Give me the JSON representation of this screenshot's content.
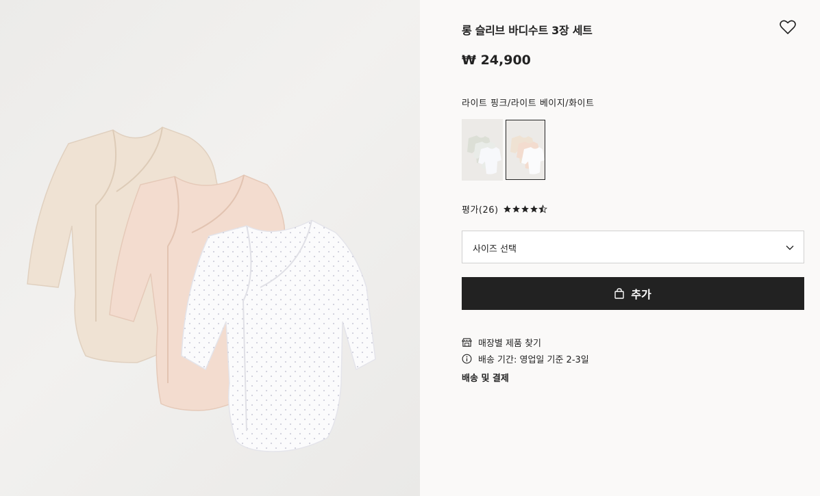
{
  "product": {
    "title": "롱 슬리브 바디수트 3장 세트",
    "price": "₩ 24,900",
    "color_name": "라이트 핑크/라이트 베이지/화이트",
    "favorite_icon": "heart-icon"
  },
  "swatches": [
    {
      "name": "swatch-gray-white",
      "selected": false
    },
    {
      "name": "swatch-pink-beige-white",
      "selected": true
    }
  ],
  "rating": {
    "label": "평가(26)",
    "stars": 4.5
  },
  "size_select": {
    "label": "사이즈 선택",
    "icon": "chevron-down-icon"
  },
  "add_button": {
    "label": "추가",
    "icon": "shopping-bag-icon"
  },
  "info_rows": {
    "store_finder": "매장별 제품 찾기",
    "shipping_time": "배송 기간: 영업일 기준 2-3일",
    "shipping_payment": "배송 및 결제"
  },
  "colors": {
    "primary_button": "#222222",
    "background": "#faf9f8"
  }
}
